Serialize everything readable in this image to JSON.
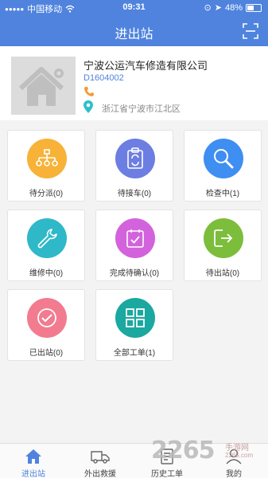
{
  "status": {
    "carrier": "中国移动",
    "time": "09:31",
    "battery": "48%"
  },
  "header": {
    "title": "进出站"
  },
  "profile": {
    "company": "宁波公运汽车修造有限公司",
    "code": "D1604002",
    "address": "浙江省宁波市江北区"
  },
  "tiles": [
    {
      "label": "待分派(0)",
      "color": "#f7b237",
      "icon": "org-chart-icon"
    },
    {
      "label": "待接车(0)",
      "color": "#6c7ee1",
      "icon": "clipboard-icon"
    },
    {
      "label": "检查中(1)",
      "color": "#3f8ef2",
      "icon": "magnifier-icon"
    },
    {
      "label": "维修中(0)",
      "color": "#2fb8c8",
      "icon": "wrench-icon"
    },
    {
      "label": "完成待确认(0)",
      "color": "#d363dc",
      "icon": "checklist-icon"
    },
    {
      "label": "待出站(0)",
      "color": "#7cbd3c",
      "icon": "exit-icon"
    },
    {
      "label": "已出站(0)",
      "color": "#f27b90",
      "icon": "check-circle-icon"
    },
    {
      "label": "全部工单(1)",
      "color": "#1aa8a0",
      "icon": "grid-icon"
    }
  ],
  "tabs": [
    {
      "label": "进出站",
      "icon": "home-icon",
      "active": true
    },
    {
      "label": "外出救援",
      "icon": "truck-icon",
      "active": false
    },
    {
      "label": "历史工单",
      "icon": "history-icon",
      "active": false
    },
    {
      "label": "我的",
      "icon": "user-icon",
      "active": false
    }
  ],
  "accent": "#4f83de",
  "watermark": {
    "brand": "2265",
    "sub": "手游网",
    "url": "2265.com"
  }
}
